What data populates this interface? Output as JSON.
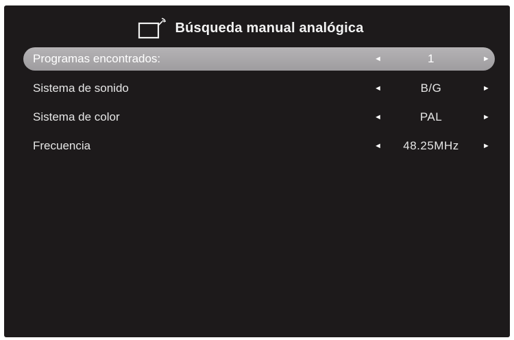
{
  "header": {
    "icon": "tv-antenna-icon",
    "title": "Búsqueda manual analógica"
  },
  "settings": [
    {
      "label": "Programas encontrados:",
      "value": "1",
      "selected": true
    },
    {
      "label": "Sistema de sonido",
      "value": "B/G",
      "selected": false
    },
    {
      "label": "Sistema de color",
      "value": "PAL",
      "selected": false
    },
    {
      "label": "Frecuencia",
      "value": "48.25MHz",
      "selected": false
    }
  ],
  "arrows": {
    "left": "◄",
    "right": "►"
  },
  "colors": {
    "background": "#1d1a1b",
    "highlight": "#aaa8aa",
    "text": "#e6e6e6"
  }
}
